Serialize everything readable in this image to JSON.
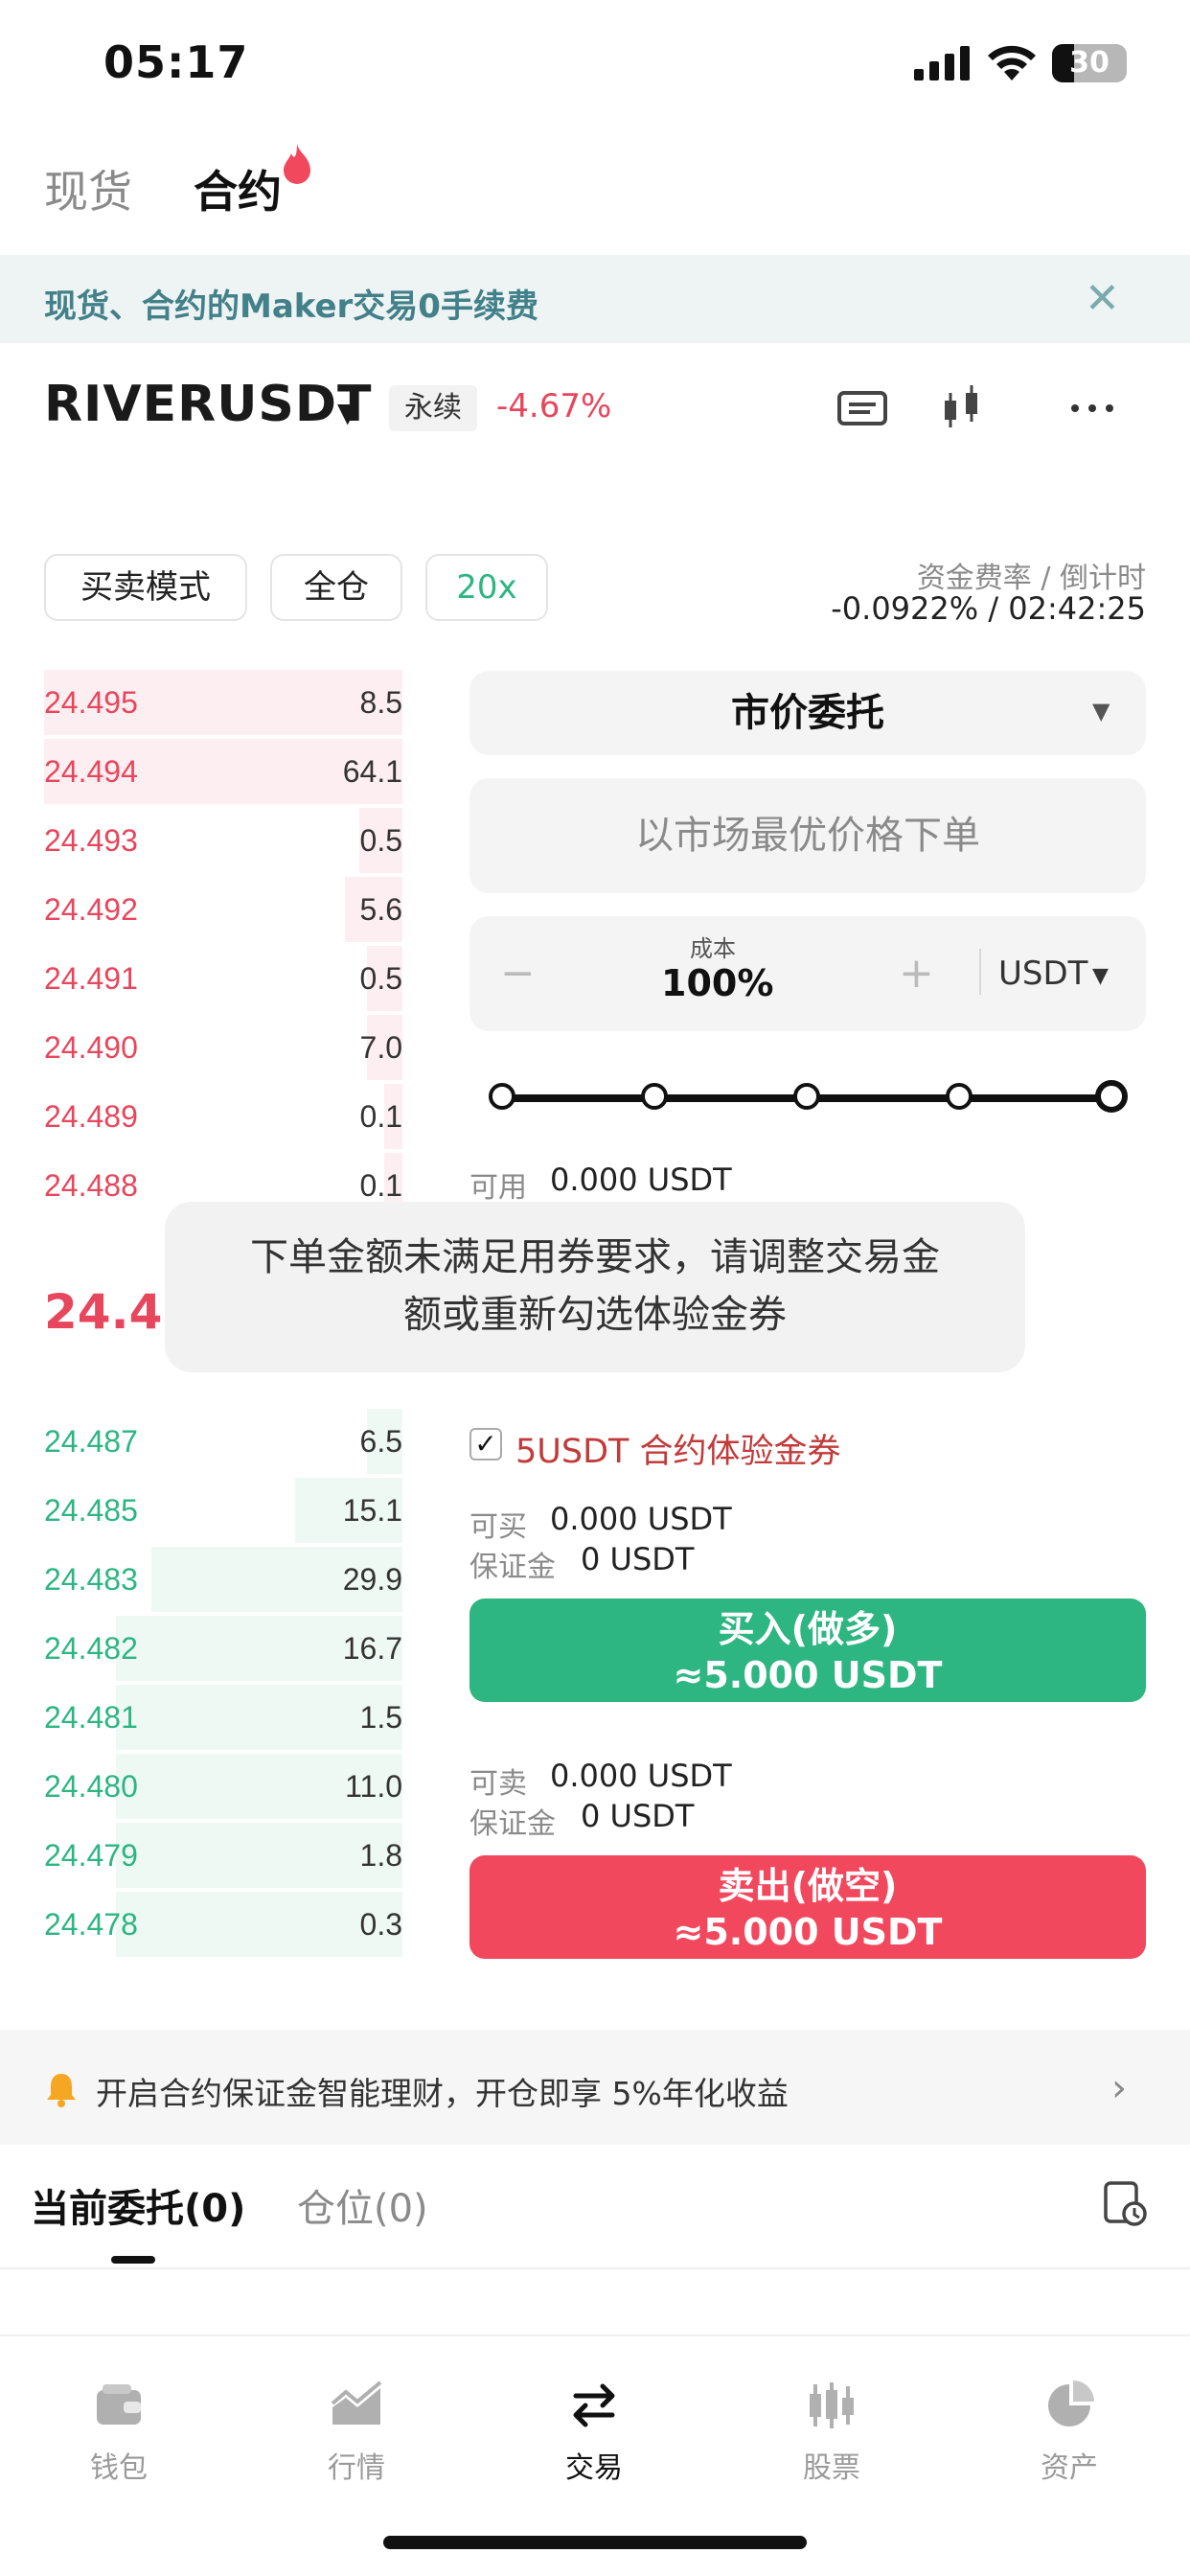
{
  "status_bar": {
    "time": "05:17",
    "battery": "30",
    "battery_level": 0.3
  },
  "top_tabs": {
    "spot": "现货",
    "contract": "合约"
  },
  "banner": {
    "text": "现货、合约的Maker交易0手续费",
    "close_icon": "close-icon"
  },
  "header": {
    "symbol": "RIVERUSDT",
    "type_badge": "永续",
    "change": "-4.67%",
    "icons": [
      "ticket-icon",
      "candlestick-chart-icon",
      "more-icon"
    ]
  },
  "mode": {
    "trade_mode": "买卖模式",
    "margin_mode": "全仓",
    "leverage": "20x",
    "funding_label": "资金费率 / 倒计时",
    "funding_value": "-0.0922% / 02:42:25"
  },
  "order_book": {
    "asks": [
      {
        "price": "24.495",
        "qty": "8.5",
        "depth": 1.0
      },
      {
        "price": "24.494",
        "qty": "64.1",
        "depth": 1.0
      },
      {
        "price": "24.493",
        "qty": "0.5",
        "depth": 0.12
      },
      {
        "price": "24.492",
        "qty": "5.6",
        "depth": 0.16
      },
      {
        "price": "24.491",
        "qty": "0.5",
        "depth": 0.1
      },
      {
        "price": "24.490",
        "qty": "7.0",
        "depth": 0.1
      },
      {
        "price": "24.489",
        "qty": "0.1",
        "depth": 0.05
      },
      {
        "price": "24.488",
        "qty": "0.1",
        "depth": 0.05
      }
    ],
    "last_price": "24.49",
    "bids": [
      {
        "price": "24.487",
        "qty": "6.5",
        "depth": 0.1
      },
      {
        "price": "24.485",
        "qty": "15.1",
        "depth": 0.3
      },
      {
        "price": "24.483",
        "qty": "29.9",
        "depth": 0.7
      },
      {
        "price": "24.482",
        "qty": "16.7",
        "depth": 0.8
      },
      {
        "price": "24.481",
        "qty": "1.5",
        "depth": 0.8
      },
      {
        "price": "24.480",
        "qty": "11.0",
        "depth": 0.8
      },
      {
        "price": "24.479",
        "qty": "1.8",
        "depth": 0.8
      },
      {
        "price": "24.478",
        "qty": "0.3",
        "depth": 0.8
      }
    ]
  },
  "order_panel": {
    "order_type": "市价委托",
    "market_note": "以市场最优价格下单",
    "cost_label": "成本",
    "cost_value": "100%",
    "cost_unit": "USDT",
    "slider_value": 1.0,
    "available_label": "可用",
    "available_value": "0.000 USDT",
    "coupon_checked": true,
    "coupon_text": "5USDT 合约体验金券",
    "buyable_label": "可买",
    "buyable_value": "0.000 USDT",
    "margin_label": "保证金",
    "margin_value": "0 USDT",
    "buy_title": "买入(做多)",
    "buy_amount": "≈5.000 USDT",
    "sellable_label": "可卖",
    "sellable_value": "0.000 USDT",
    "sell_margin_label": "保证金",
    "sell_margin_value": "0 USDT",
    "sell_title": "卖出(做空)",
    "sell_amount": "≈5.000 USDT"
  },
  "toast": {
    "line1": "下单金额未满足用券要求，请调整交易金",
    "line2": "额或重新勾选体验金券"
  },
  "promo": {
    "text": "开启合约保证金智能理财，开仓即享 5%年化收益"
  },
  "bottom_tabs": {
    "orders": "当前委托(0)",
    "positions": "仓位(0)"
  },
  "nav": [
    {
      "label": "钱包",
      "icon": "wallet-icon"
    },
    {
      "label": "行情",
      "icon": "market-chart-icon"
    },
    {
      "label": "交易",
      "icon": "trade-arrows-icon"
    },
    {
      "label": "股票",
      "icon": "stocks-icon"
    },
    {
      "label": "资产",
      "icon": "assets-pie-icon"
    }
  ],
  "colors": {
    "red": "#e8465c",
    "green": "#2db582",
    "teal_banner": "#42808a"
  }
}
